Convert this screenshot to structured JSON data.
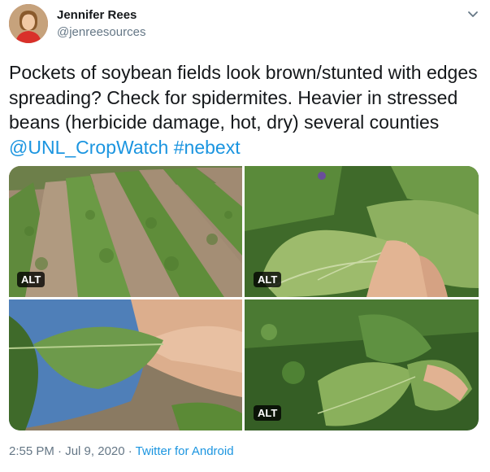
{
  "author": {
    "name": "Jennifer Rees",
    "handle": "@jenreesources"
  },
  "tweet": {
    "text": "Pockets of soybean fields look brown/stunted with edges spreading? Check for spidermites. Heavier in stressed beans (herbicide damage, hot, dry) several counties ",
    "mention": "@UNL_CropWatch",
    "hashtag": "#nebext"
  },
  "media": {
    "alt_label": "ALT",
    "photos": [
      {
        "subject": "soybean field rows"
      },
      {
        "subject": "soybean leaf held in hand"
      },
      {
        "subject": "underside of soybean leaf"
      },
      {
        "subject": "soybean plant leaves"
      }
    ]
  },
  "meta": {
    "time": "2:55 PM",
    "sep1": " · ",
    "date": "Jul 9, 2020",
    "sep2": " · ",
    "source": "Twitter for Android"
  },
  "icons": {
    "caret": "chevron-down-icon"
  },
  "colors": {
    "link": "#1b95e0",
    "muted": "#657786",
    "text": "#14171a"
  }
}
